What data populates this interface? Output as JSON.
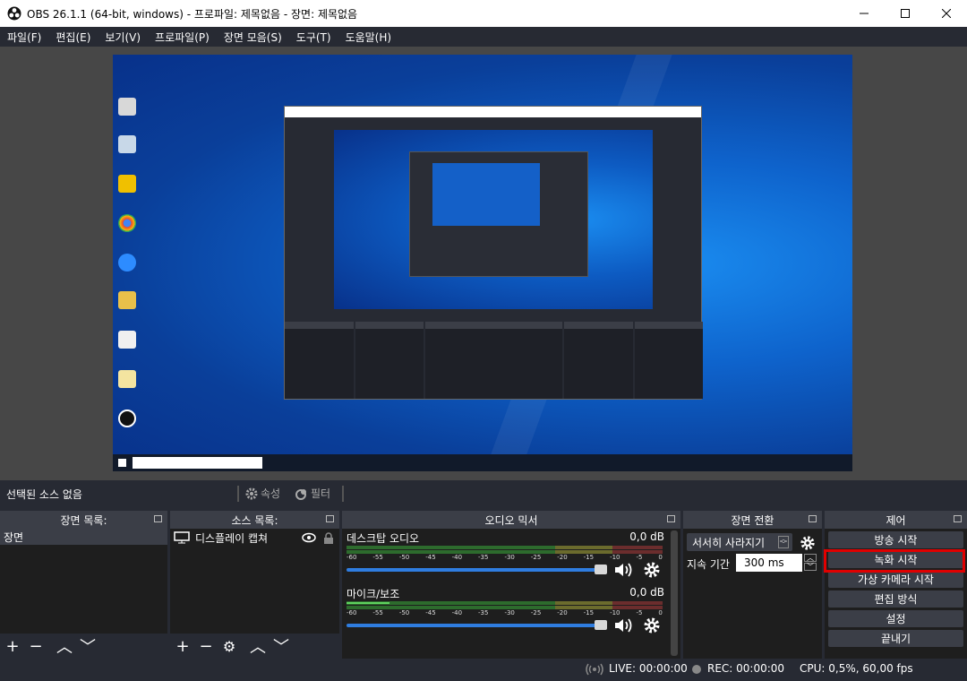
{
  "window": {
    "title": "OBS 26.1.1 (64-bit, windows) - 프로파일: 제목없음 - 장면: 제목없음"
  },
  "menu": [
    "파일(F)",
    "편집(E)",
    "보기(V)",
    "프로파일(P)",
    "장면 모음(S)",
    "도구(T)",
    "도움말(H)"
  ],
  "source_toolbar": {
    "selected": "선택된 소스 없음",
    "properties": "속성",
    "filters": "필터"
  },
  "scenes": {
    "title": "장면 목록:",
    "items": [
      "장면"
    ]
  },
  "sources": {
    "title": "소스 목록:",
    "items": [
      "디스플레이 캡쳐"
    ]
  },
  "mixer": {
    "title": "오디오 믹서",
    "scale": [
      "-60",
      "-55",
      "-50",
      "-45",
      "-40",
      "-35",
      "-30",
      "-25",
      "-20",
      "-15",
      "-10",
      "-5",
      "0"
    ],
    "tracks": [
      {
        "name": "데스크탑 오디오",
        "db": "0,0 dB"
      },
      {
        "name": "마이크/보조",
        "db": "0,0 dB"
      }
    ]
  },
  "transitions": {
    "title": "장면 전환",
    "type": "서서히 사라지기",
    "duration_label": "지속 기간",
    "duration": "300 ms"
  },
  "controls": {
    "title": "제어",
    "buttons": [
      "방송 시작",
      "녹화 시작",
      "가상 카메라 시작",
      "편집 방식",
      "설정",
      "끝내기"
    ]
  },
  "status": {
    "live": "LIVE: 00:00:00",
    "rec": "REC: 00:00:00",
    "cpu": "CPU: 0,5%, 60,00 fps"
  },
  "colors": {
    "accent": "#2f7de0",
    "highlight": "#e00000"
  }
}
